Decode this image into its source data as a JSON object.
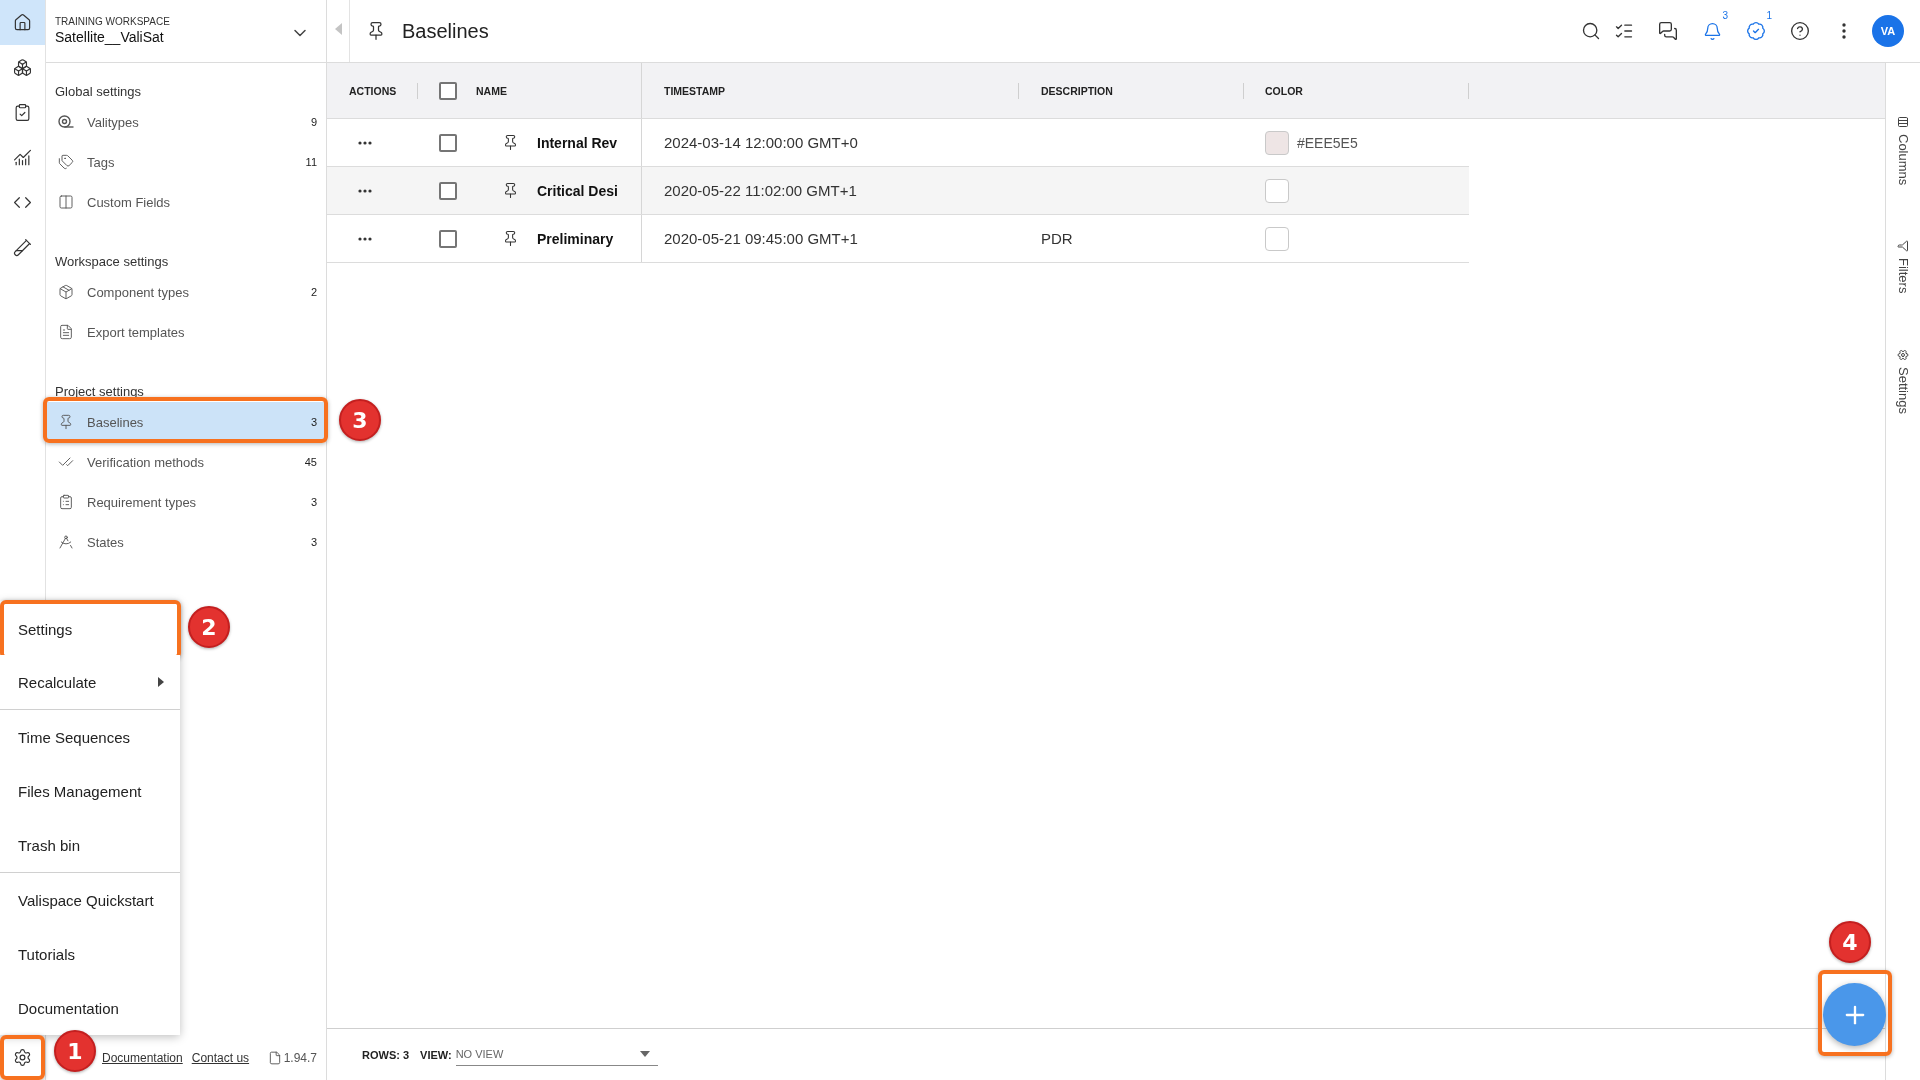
{
  "rail": {
    "items": [
      {
        "selected": true
      },
      {
        "selected": false
      },
      {
        "selected": false
      },
      {
        "selected": false
      },
      {
        "selected": false
      },
      {
        "selected": false
      }
    ],
    "settings_button": {
      "callout": "1"
    }
  },
  "workspace": {
    "label": "TRAINING WORKSPACE",
    "name": "Satellite__ValiSat"
  },
  "sidebar": {
    "sections": [
      {
        "title": "Global settings",
        "items": [
          {
            "label": "Valitypes",
            "count": "9",
            "selected": false
          },
          {
            "label": "Tags",
            "count": "11",
            "selected": false
          },
          {
            "label": "Custom Fields",
            "selected": false
          }
        ]
      },
      {
        "title": "Workspace settings",
        "items": [
          {
            "label": "Component types",
            "count": "2",
            "selected": false
          },
          {
            "label": "Export templates",
            "selected": false
          }
        ]
      },
      {
        "title": "Project settings",
        "items": [
          {
            "label": "Baselines",
            "count": "3",
            "selected": true,
            "callout": "3"
          },
          {
            "label": "Verification methods",
            "count": "45",
            "selected": false
          },
          {
            "label": "Requirement types",
            "count": "3",
            "selected": false
          },
          {
            "label": "States",
            "count": "3",
            "selected": false
          }
        ]
      }
    ]
  },
  "sidebar_footer": {
    "links": [
      "Documentation",
      "Contact us"
    ],
    "version": "1.94.7"
  },
  "settings_menu": {
    "open": true,
    "groups": [
      {
        "items": [
          {
            "label": "Settings",
            "submenu": false,
            "callout": "2"
          },
          {
            "label": "Recalculate",
            "submenu": true
          }
        ]
      },
      {
        "items": [
          {
            "label": "Time Sequences",
            "submenu": false
          },
          {
            "label": "Files Management",
            "submenu": false
          },
          {
            "label": "Trash bin",
            "submenu": false
          }
        ]
      },
      {
        "items": [
          {
            "label": "Valispace Quickstart",
            "submenu": false
          },
          {
            "label": "Tutorials",
            "submenu": false
          },
          {
            "label": "Documentation",
            "submenu": false
          }
        ]
      }
    ]
  },
  "header": {
    "title": "Baselines",
    "notifications": "3",
    "tasks": "1",
    "avatar": "VA"
  },
  "table": {
    "columns": [
      "ACTIONS",
      "NAME",
      "TIMESTAMP",
      "DESCRIPTION",
      "COLOR"
    ],
    "select_all": {
      "checked": false
    },
    "rows": [
      {
        "checked": false,
        "name": "Internal Rev",
        "timestamp": "2024-03-14 12:00:00 GMT+0",
        "color": "#eee5e5",
        "color_label": "#EEE5E5"
      },
      {
        "checked": false,
        "name": "Critical Desi",
        "timestamp": "2020-05-22 11:02:00 GMT+1"
      },
      {
        "checked": false,
        "name": "Preliminary",
        "timestamp": "2020-05-21 09:45:00 GMT+1",
        "description": "PDR"
      }
    ]
  },
  "footer": {
    "rows": "ROWS: 3",
    "view_label": "VIEW:",
    "view": "NO VIEW"
  },
  "side_tabs": [
    "Columns",
    "Filters",
    "Settings"
  ],
  "add_button": {
    "callout": "4"
  }
}
